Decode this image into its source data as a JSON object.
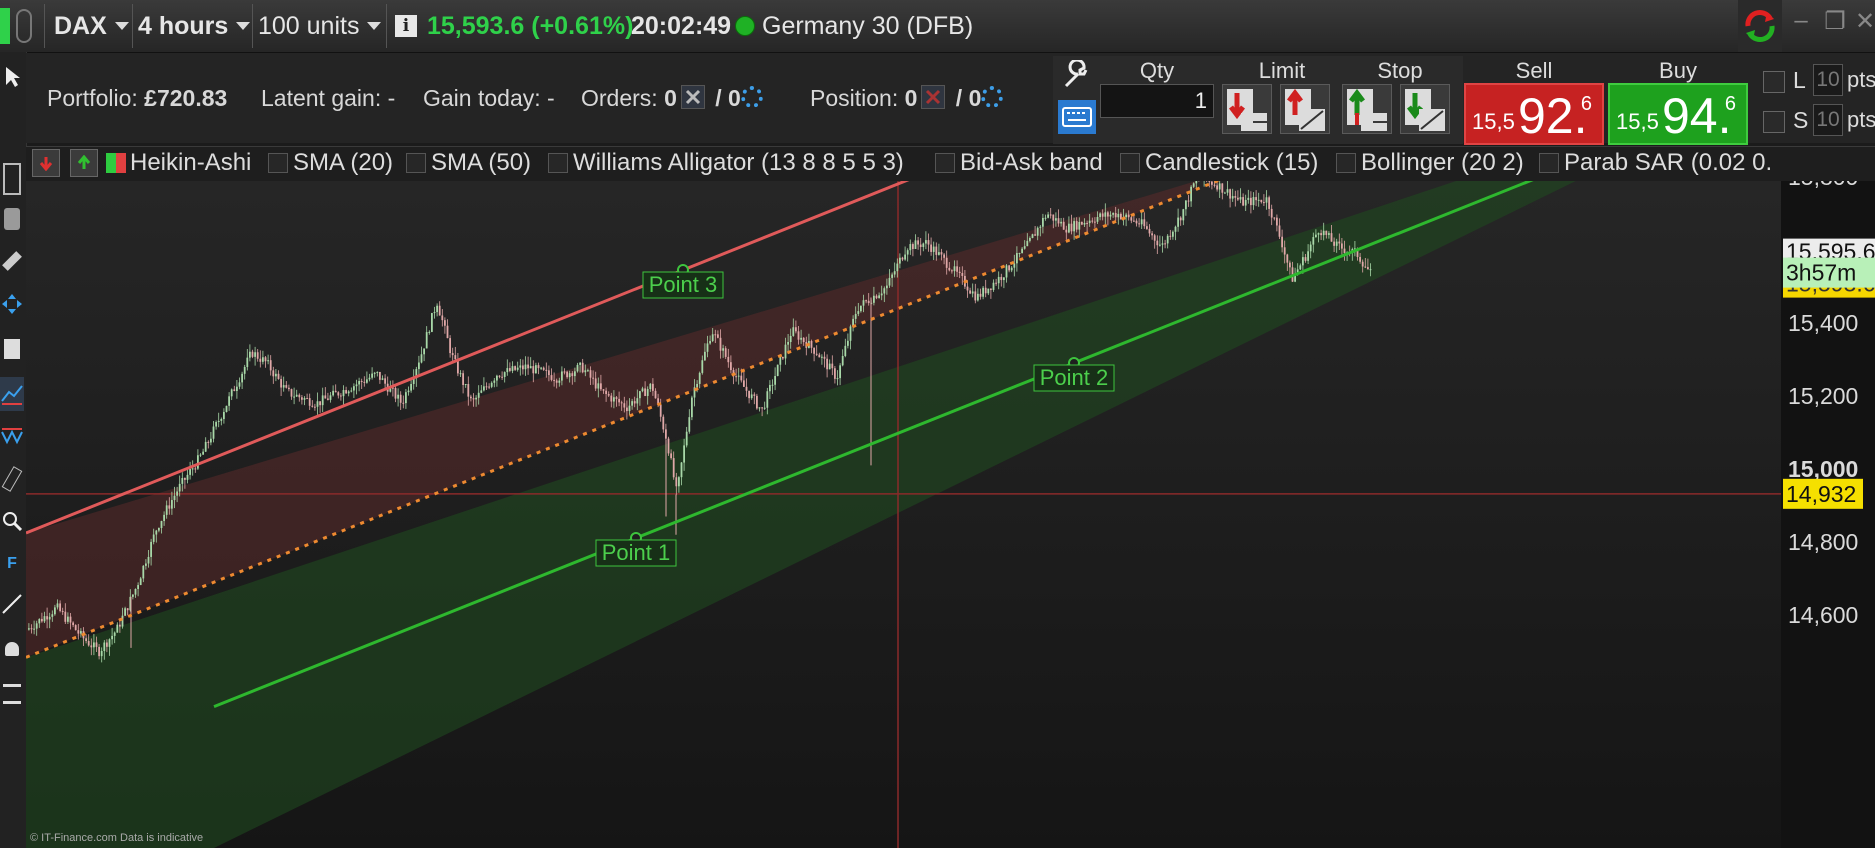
{
  "topbar": {
    "instrument": "DAX",
    "timeframe": "4 hours",
    "units": "100 units",
    "price_change": "15,593.6 (+0.61%)",
    "time": "20:02:49",
    "market_name": "Germany 30 (DFB)"
  },
  "portfolio": {
    "portfolio_label": "Portfolio:",
    "portfolio_value": "£720.83",
    "latent_gain": "Latent gain: -",
    "gain_today": "Gain today: -",
    "orders_label": "Orders:",
    "orders_count": "0",
    "orders_slash": "/ 0",
    "position_label": "Position:",
    "position_count": "0",
    "position_slash": "/ 0"
  },
  "order_panel": {
    "qty_label": "Qty",
    "qty_value": "1",
    "limit_label": "Limit",
    "stop_label": "Stop",
    "sell_label": "Sell",
    "sell_small": "15,5",
    "sell_big": "92.",
    "sell_sup": "6",
    "buy_label": "Buy",
    "buy_small": "15,5",
    "buy_big": "94.",
    "buy_sup": "6",
    "limit_letter": "L",
    "limit_pts_value": "10",
    "stop_letter": "S",
    "stop_pts_value": "10",
    "pts": "pts",
    "sell_color": "#cc2222",
    "buy_color": "#1fa21f"
  },
  "indicators": [
    "Heikin-Ashi",
    "SMA (20)",
    "SMA (50)",
    "Williams Alligator (13 8 8 5 5 3)",
    "Bid-Ask band",
    "Candlestick (15)",
    "Bollinger (20 2)",
    "Parab SAR (0.02 0."
  ],
  "chart_data": {
    "type": "candlestick",
    "yticks": [
      "15,800",
      "15,600",
      "15,400",
      "15,200",
      "15,000",
      "14,800",
      "14,600"
    ],
    "ylim": [
      14350,
      15950
    ],
    "current_price_label": "15,595.6",
    "countdown_label": "3h57m",
    "price_tag_behind": "15,593.6",
    "crosshair_price_label": "14,932",
    "channel_points": [
      {
        "label": "Point 1",
        "price": 14820
      },
      {
        "label": "Point 2",
        "price": 15285
      },
      {
        "label": "Point 3",
        "price": 15520
      }
    ],
    "watermark": "© IT-Finance.com  Data is indicative",
    "colors": {
      "upper_line": "#e05a5a",
      "lower_line": "#2eb82e",
      "mid_line": "#e88a2e",
      "bull_candle": "#a8d8a8",
      "bear_candle": "#e0a8a8"
    }
  }
}
